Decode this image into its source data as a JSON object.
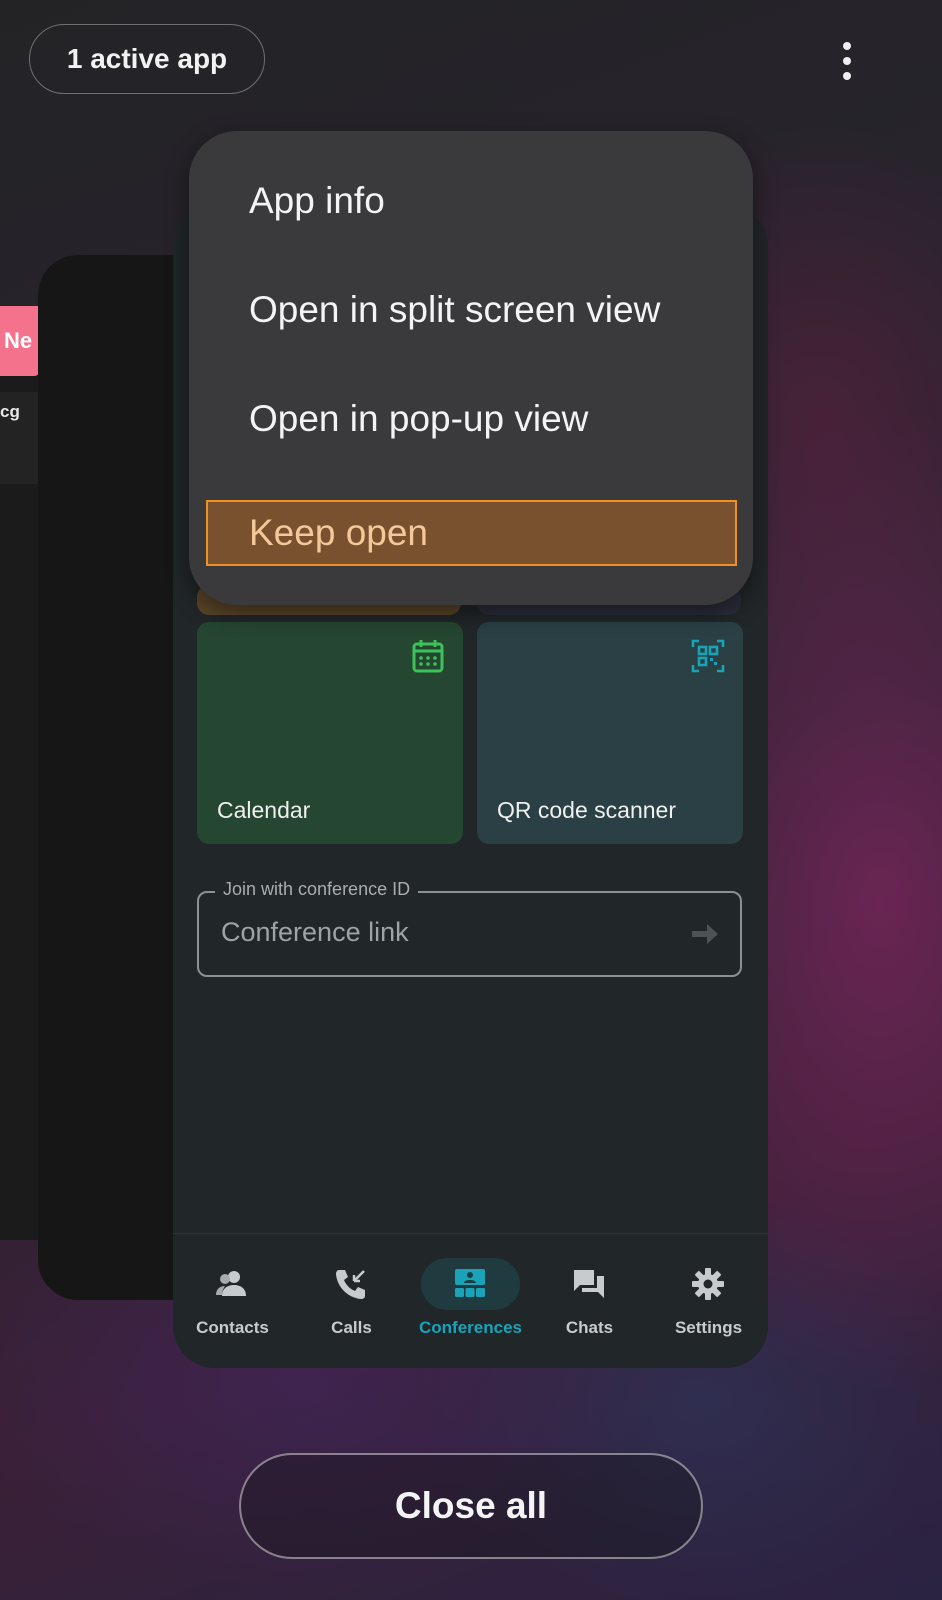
{
  "header": {
    "active_apps_label": "1 active app"
  },
  "background_cards": {
    "pink_tab_text": "Ne",
    "partial_text": "cg"
  },
  "app": {
    "tiles": [
      {
        "label": "Calendar",
        "icon": "calendar-icon",
        "color": "#254631"
      },
      {
        "label": "QR code scanner",
        "icon": "qr-code-icon",
        "color": "#2a4045"
      }
    ],
    "conference_field": {
      "legend": "Join with conference ID",
      "placeholder": "Conference link"
    },
    "nav": [
      {
        "label": "Contacts",
        "icon": "contacts-icon",
        "active": false
      },
      {
        "label": "Calls",
        "icon": "calls-icon",
        "active": false
      },
      {
        "label": "Conferences",
        "icon": "conferences-icon",
        "active": true
      },
      {
        "label": "Chats",
        "icon": "chats-icon",
        "active": false
      },
      {
        "label": "Settings",
        "icon": "settings-icon",
        "active": false
      }
    ],
    "accent_color": "#1aa3b8"
  },
  "menu": {
    "items": [
      {
        "label": "App info"
      },
      {
        "label": "Open in split screen view"
      },
      {
        "label": "Open in pop-up view"
      },
      {
        "label": "Keep open",
        "highlighted": true
      }
    ]
  },
  "footer": {
    "close_all_label": "Close all"
  }
}
